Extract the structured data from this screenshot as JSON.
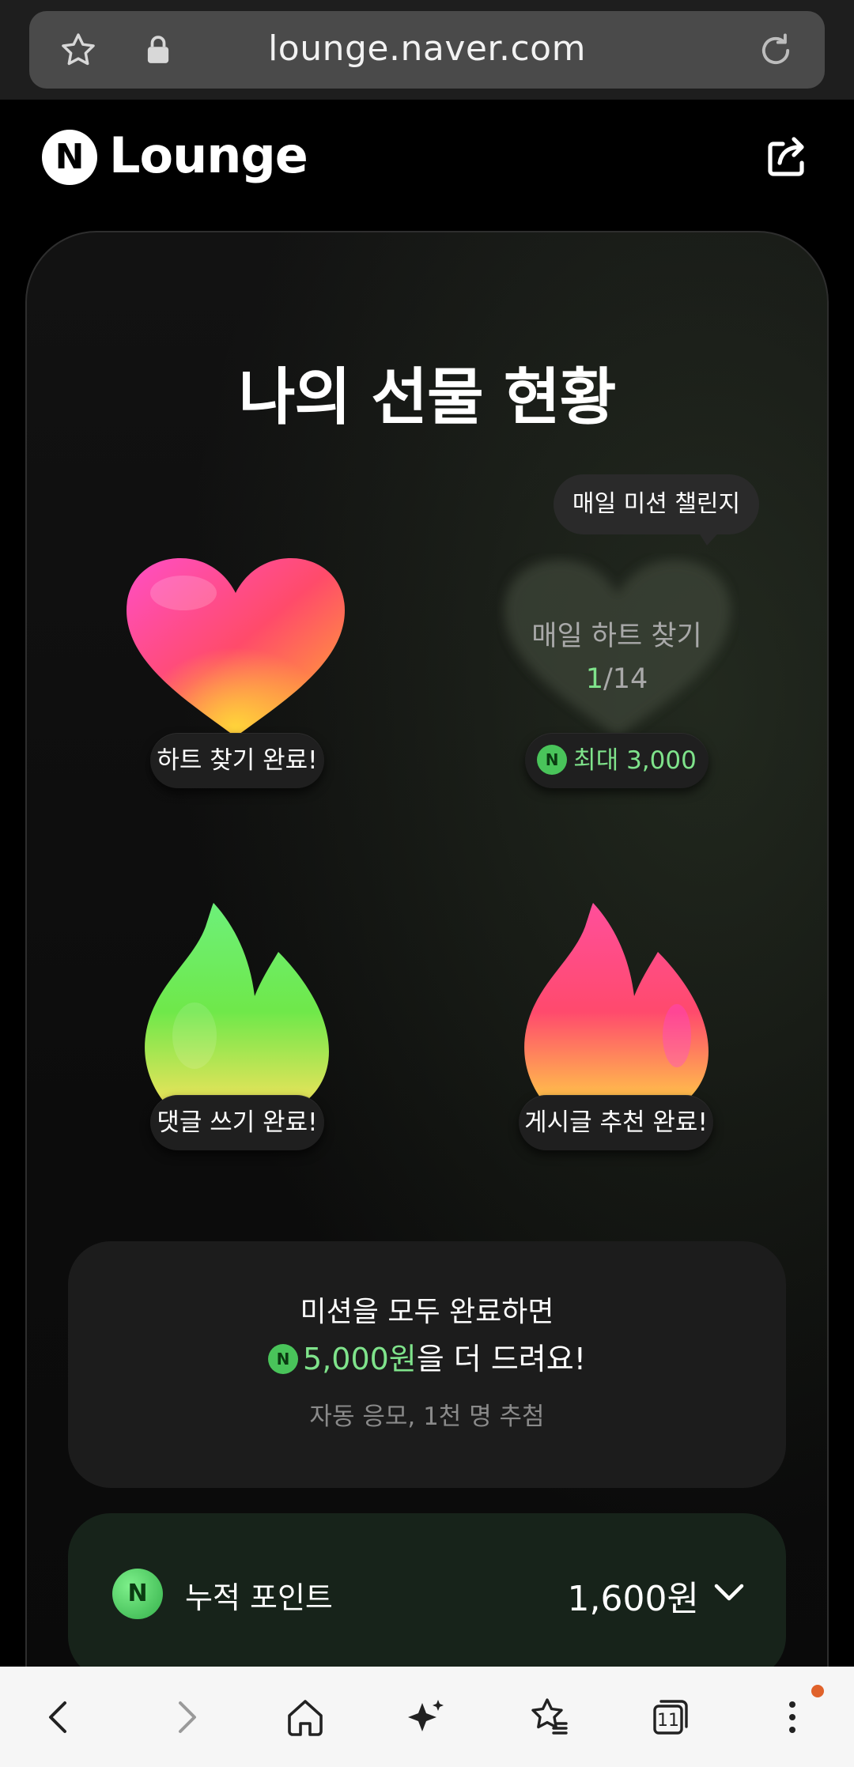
{
  "browser": {
    "url": "lounge.naver.com"
  },
  "header": {
    "logo_letter": "N",
    "title": "Lounge"
  },
  "card": {
    "title": "나의 선물 현황",
    "tooltip": "매일 미션 챌린지",
    "items": [
      {
        "label": "하트 찾기 완료!"
      },
      {
        "ghost_title": "매일 하트 찾기",
        "progress_current": "1",
        "progress_total": "/14",
        "reward_prefix": "최대 ",
        "reward_value": "3,000"
      },
      {
        "label": "댓글 쓰기 완료!"
      },
      {
        "label": "게시글 추천 완료!"
      }
    ],
    "coin_letter": "N"
  },
  "info": {
    "line1": "미션을 모두 완료하면",
    "amount": "5,000원",
    "line2_suffix": "을 더 드려요!",
    "line3": "자동 응모, 1천 명 추첨"
  },
  "points": {
    "label": "누적 포인트",
    "value": "1,600원"
  },
  "bottom_nav": {
    "tab_count": "11"
  },
  "colors": {
    "accent_green": "#7fe38b",
    "coin_green": "#49c45a",
    "notification_dot": "#e0622b"
  }
}
